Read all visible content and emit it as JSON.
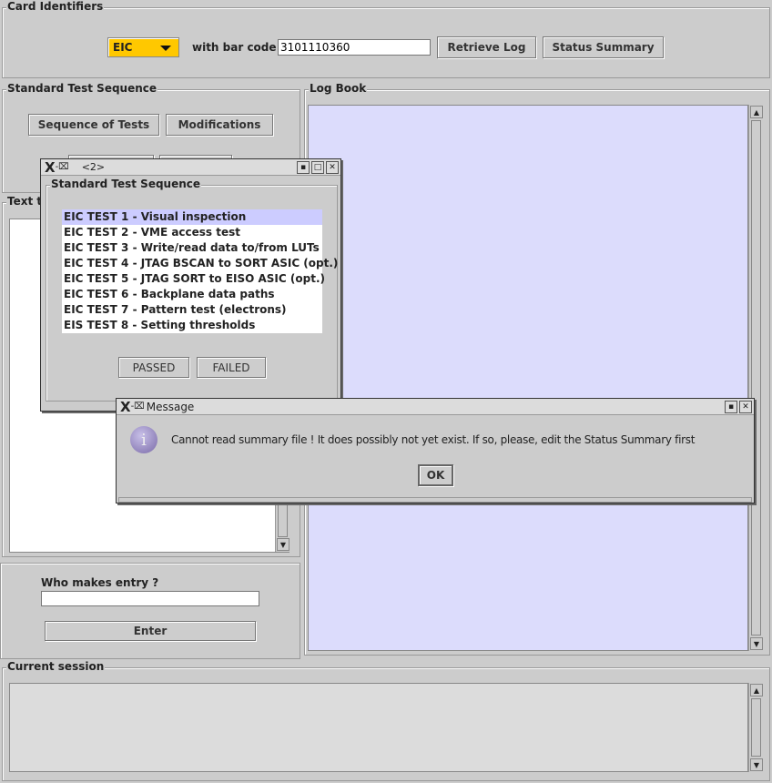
{
  "card_identifiers": {
    "legend": "Card Identifiers",
    "card_type": "EIC",
    "bar_code_label": "with bar code",
    "bar_code": "3101110360",
    "retrieve_log": "Retrieve Log",
    "status_summary": "Status Summary",
    "combo_color": "#ffc800"
  },
  "standard_test_sequence": {
    "legend": "Standard Test Sequence",
    "sequence_of_tests": "Sequence of Tests",
    "modifications": "Modifications"
  },
  "text_panel": {
    "legend": "Text t"
  },
  "log_book": {
    "legend": "Log Book",
    "bg_color": "#dcdcfc"
  },
  "entry": {
    "label": "Who makes entry ?",
    "value": "",
    "enter": "Enter"
  },
  "current_session": {
    "legend": "Current session"
  },
  "sequence_dialog": {
    "title": "<2>",
    "legend": "Standard Test Sequence",
    "items": [
      "EIC TEST 1 - Visual inspection",
      "EIC TEST 2 - VME access test",
      "EIC TEST 3 - Write/read data to/from LUTs",
      "EIC TEST 4 - JTAG BSCAN to SORT ASIC (opt.)",
      "EIC TEST 5 - JTAG SORT to EISO ASIC (opt.)",
      "EIC TEST 6 - Backplane data paths",
      "EIC TEST 7 - Pattern test (electrons)",
      "EIS TEST 8 - Setting thresholds"
    ],
    "selected_index": 0,
    "passed": "PASSED",
    "failed": "FAILED"
  },
  "message_dialog": {
    "title": "Message",
    "text": "Cannot read summary file ! It does possibly not yet exist. If so, please, edit the Status Summary first",
    "ok": "OK",
    "icon": "info-icon"
  }
}
